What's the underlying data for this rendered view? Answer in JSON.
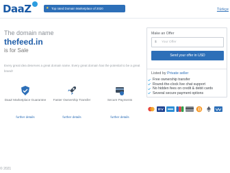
{
  "header": {
    "logo_text": "DaaZ",
    "badge_text": "Top rated Domain Marketplace of 2020",
    "language_label": "Türkçe"
  },
  "hero": {
    "kicker": "The domain name",
    "domain": "thefeed.in",
    "status": "is for Sale",
    "blurb": "Every great idea deserves a great domain name. Every great domain has the potential to be a great brand!"
  },
  "features": [
    {
      "label": "DaaZ Marketplace Guarantee",
      "more": "further details",
      "icon": "shield-icon"
    },
    {
      "label": "Faster Ownership Transfer",
      "more": "further details",
      "icon": "rocket-icon"
    },
    {
      "label": "Secure Payments",
      "more": "further details",
      "icon": "payment-icon"
    }
  ],
  "offer": {
    "title": "Make an Offer",
    "currency": "$",
    "placeholder": "Your Offer",
    "send_label": "Send your offer in USD",
    "listed_prefix": "Listed by",
    "listed_by": "Private seller"
  },
  "perks": [
    "Free ownership transfer",
    "Round-the-clock live chat support",
    "No hidden fees on credit & debit cards",
    "Several secure payment options"
  ],
  "payments": [
    "mastercard-icon",
    "visa-icon",
    "amex-icon",
    "jcb-icon",
    "card-icon",
    "bitcoin-icon",
    "ethereum-icon",
    "wire-icon"
  ],
  "colors": {
    "brand": "#2d6fb8",
    "accent": "#1f5da8",
    "check": "#2d9de0"
  },
  "footer": {
    "copyright": "© 2021"
  }
}
